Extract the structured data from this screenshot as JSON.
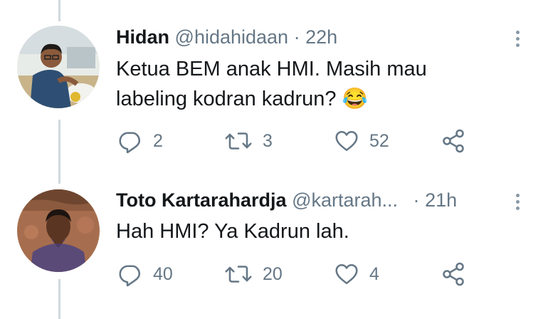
{
  "tweets": [
    {
      "name": "Hidan",
      "handle": "@hidahidaan",
      "separator": "·",
      "time": "22h",
      "text_lines": [
        "Ketua BEM anak HMI. Masih mau",
        "labeling kodran kadrun? 😂"
      ],
      "replies": "2",
      "retweets": "3",
      "likes": "52",
      "avatar_color": "#5a6b7e"
    },
    {
      "name": "Toto Kartarahardja",
      "handle": "@kartarah...",
      "separator": "·",
      "time": "21h",
      "text_lines": [
        "Hah HMI? Ya Kadrun lah."
      ],
      "replies": "40",
      "retweets": "20",
      "likes": "4",
      "avatar_color": "#a0684a"
    }
  ],
  "icons": {
    "reply": "reply-icon",
    "retweet": "retweet-icon",
    "like": "heart-icon",
    "share": "share-icon",
    "more": "more-options-icon"
  },
  "colors": {
    "text": "#14171a",
    "secondary": "#657786",
    "thread_line": "#cfd9de"
  }
}
